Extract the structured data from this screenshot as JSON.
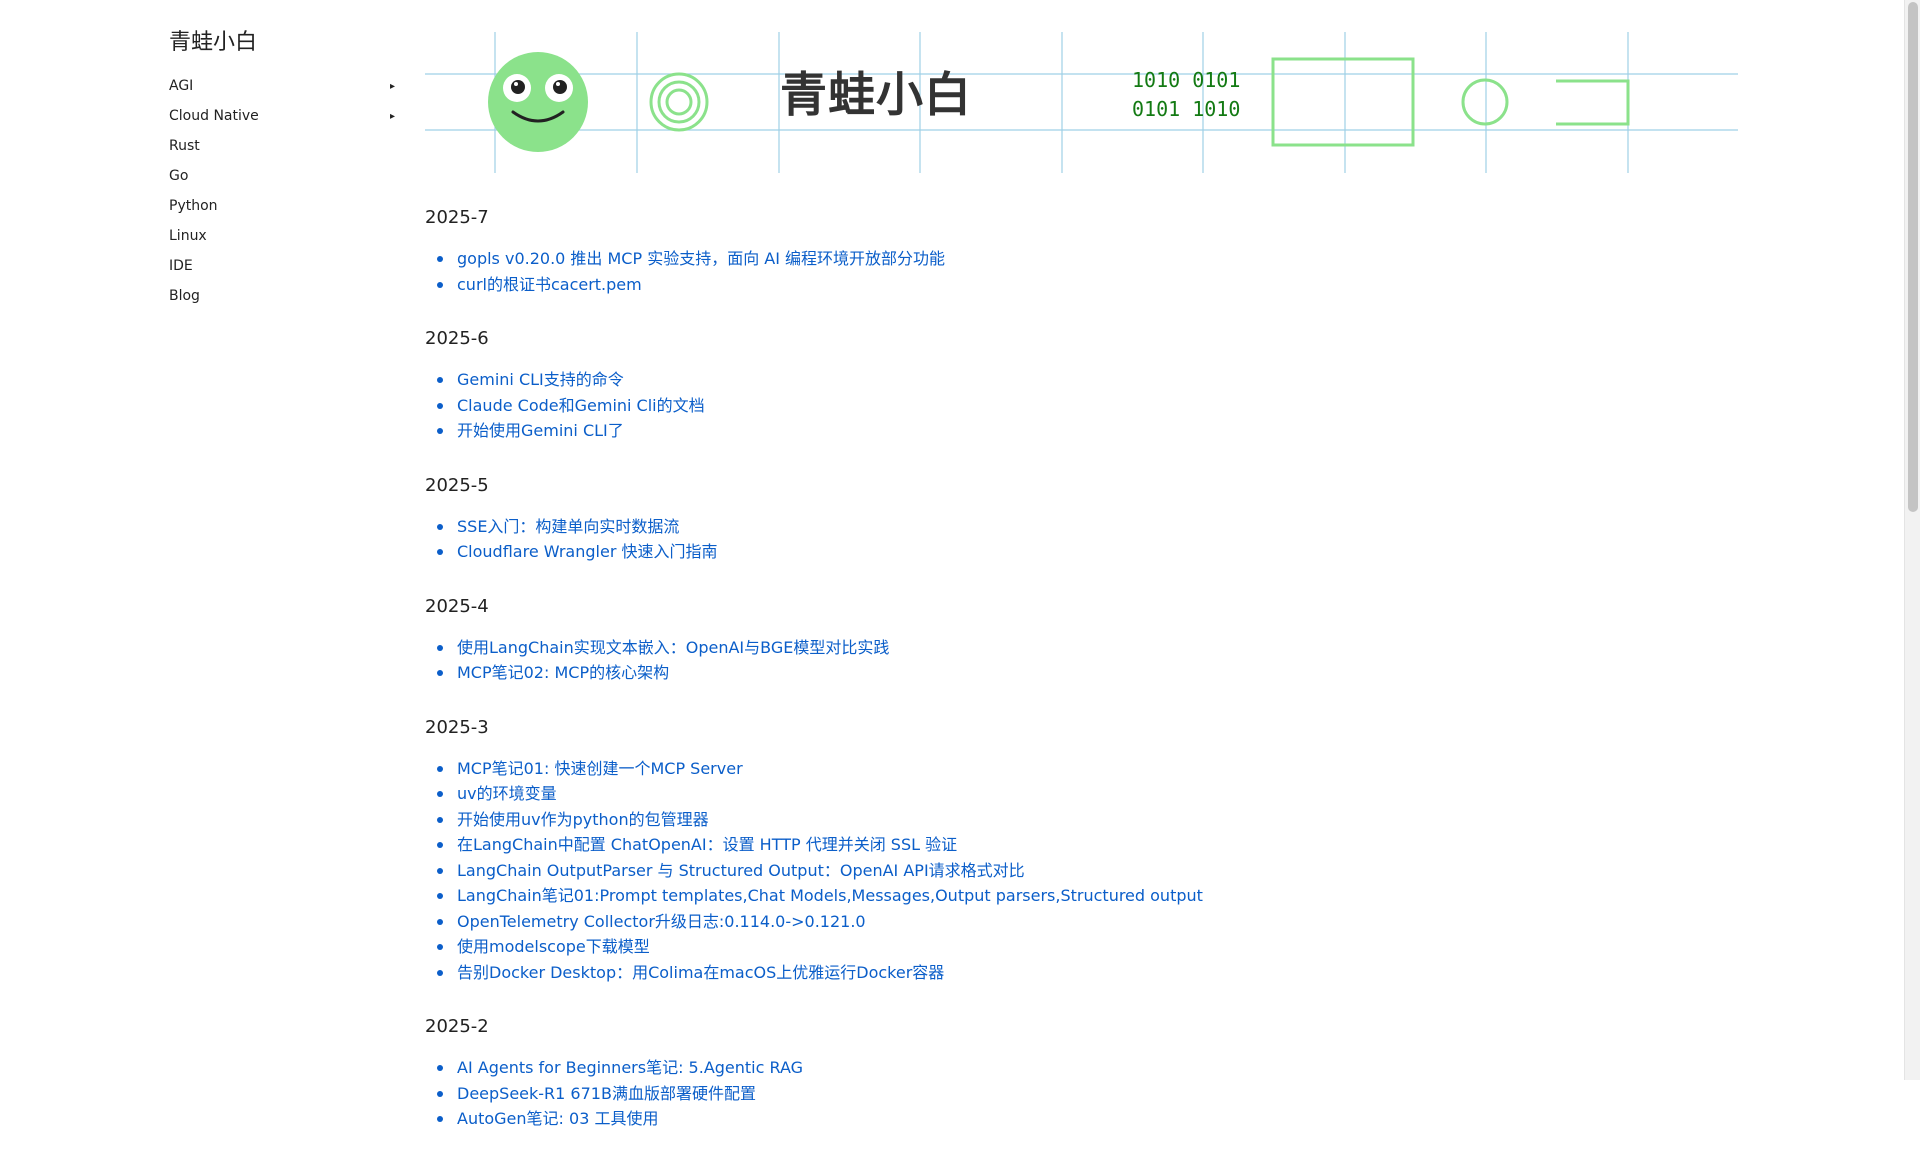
{
  "sidebar": {
    "title": "青蛙小白",
    "items": [
      {
        "label": "AGI",
        "arrow": "▸"
      },
      {
        "label": "Cloud Native",
        "arrow": "▸"
      },
      {
        "label": "Rust"
      },
      {
        "label": "Go"
      },
      {
        "label": "Python"
      },
      {
        "label": "Linux"
      },
      {
        "label": "IDE"
      },
      {
        "label": "Blog"
      }
    ]
  },
  "banner": {
    "title": "青蛙小白",
    "binary_line1": "1010 0101",
    "binary_line2": "0101 1010"
  },
  "months": [
    {
      "title": "2025-7",
      "posts": [
        "gopls v0.20.0 推出 MCP 实验支持，面向 AI 编程环境开放部分功能",
        "curl的根证书cacert.pem"
      ]
    },
    {
      "title": "2025-6",
      "posts": [
        "Gemini CLI支持的命令",
        "Claude Code和Gemini Cli的文档",
        "开始使用Gemini CLI了"
      ]
    },
    {
      "title": "2025-5",
      "posts": [
        "SSE入门：构建单向实时数据流",
        "Cloudflare Wrangler 快速入门指南"
      ]
    },
    {
      "title": "2025-4",
      "posts": [
        "使用LangChain实现文本嵌入：OpenAI与BGE模型对比实践",
        "MCP笔记02: MCP的核心架构"
      ]
    },
    {
      "title": "2025-3",
      "posts": [
        "MCP笔记01: 快速创建一个MCP Server",
        "uv的环境变量",
        "开始使用uv作为python的包管理器",
        "在LangChain中配置 ChatOpenAI：设置 HTTP 代理并关闭 SSL 验证",
        "LangChain OutputParser 与 Structured Output：OpenAI API请求格式对比",
        "LangChain笔记01:Prompt templates,Chat Models,Messages,Output parsers,Structured output",
        "OpenTelemetry Collector升级日志:0.114.0->0.121.0",
        "使用modelscope下载模型",
        "告别Docker Desktop：用Colima在macOS上优雅运行Docker容器"
      ]
    },
    {
      "title": "2025-2",
      "posts": [
        "AI Agents for Beginners笔记: 5.Agentic RAG",
        "DeepSeek-R1 671B满血版部署硬件配置",
        "AutoGen笔记: 03 工具使用"
      ]
    }
  ],
  "colors": {
    "link": "#0b5ec9",
    "frog_green": "#8be28b",
    "banner_lines": "#9fd0e6",
    "binary_text": "#137a13"
  },
  "icons": [
    "frog-logo-icon",
    "ring-icon",
    "circle-icon",
    "rectangle-icon"
  ]
}
